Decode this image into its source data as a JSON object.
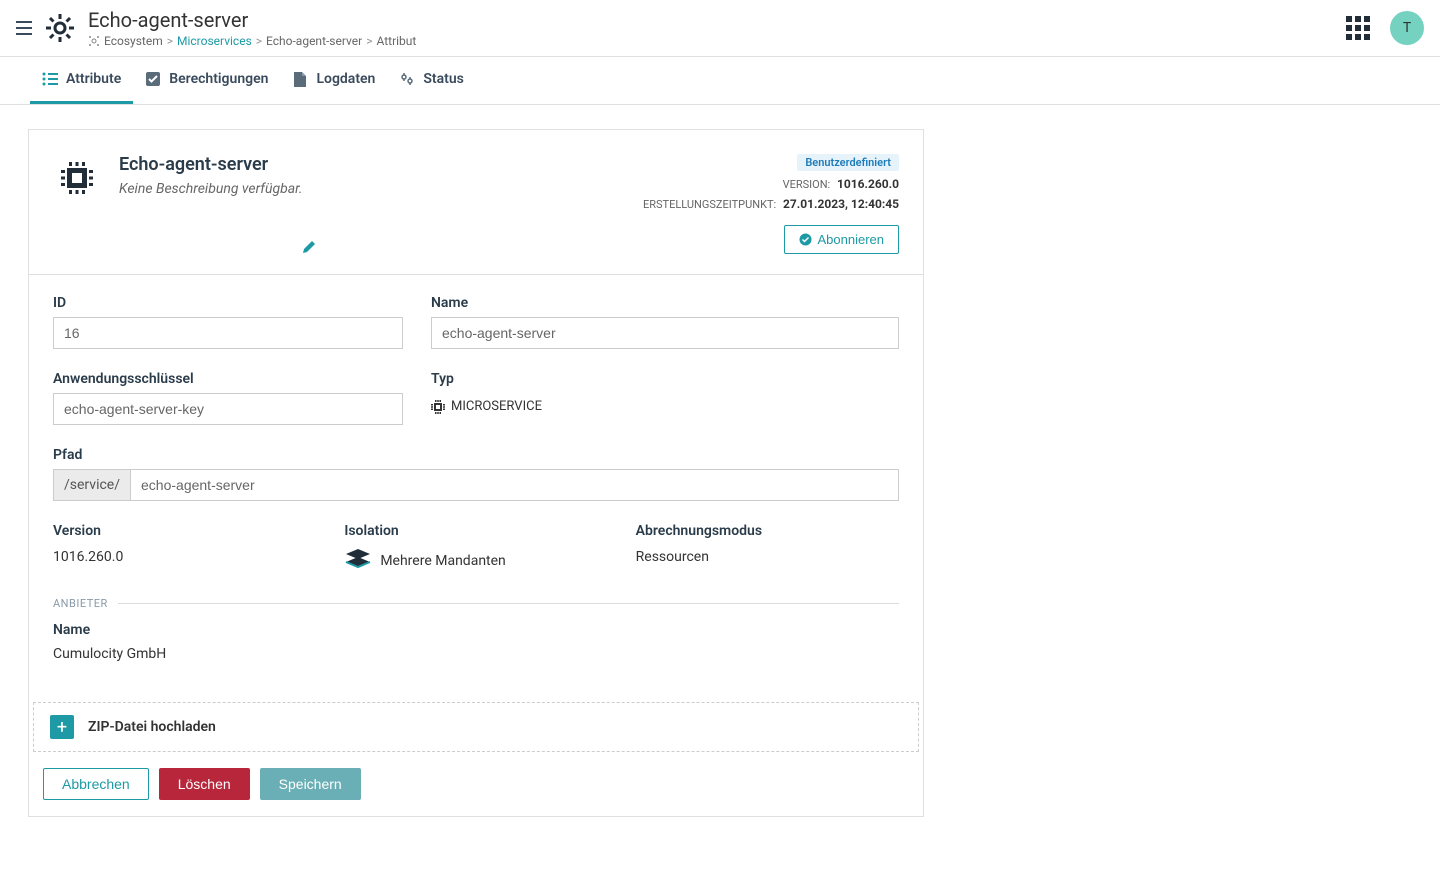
{
  "header": {
    "title": "Echo-agent-server",
    "avatar": "T"
  },
  "breadcrumb": {
    "items": [
      "Ecosystem",
      "Microservices",
      "Echo-agent-server",
      "Attribut"
    ],
    "linkIndex": 1
  },
  "tabs": [
    {
      "label": "Attribute",
      "icon": "list"
    },
    {
      "label": "Berechtigungen",
      "icon": "check"
    },
    {
      "label": "Logdaten",
      "icon": "file"
    },
    {
      "label": "Status",
      "icon": "gear"
    }
  ],
  "card": {
    "title": "Echo-agent-server",
    "description": "Keine Beschreibung verfügbar.",
    "badge": "Benutzerdefiniert",
    "versionLabel": "VERSION:",
    "versionValue": "1016.260.0",
    "createdLabel": "ERSTELLUNGSZEITPUNKT:",
    "createdValue": "27.01.2023, 12:40:45",
    "subscribe": "Abonnieren"
  },
  "form": {
    "idLabel": "ID",
    "idValue": "16",
    "nameLabel": "Name",
    "nameValue": "echo-agent-server",
    "appKeyLabel": "Anwendungsschlüssel",
    "appKeyValue": "echo-agent-server-key",
    "typeLabel": "Typ",
    "typeValue": "MICROSERVICE",
    "pathLabel": "Pfad",
    "pathPrefix": "/service/",
    "pathValue": "echo-agent-server",
    "versionLabel": "Version",
    "versionValue": "1016.260.0",
    "isolationLabel": "Isolation",
    "isolationValue": "Mehrere Mandanten",
    "billingLabel": "Abrechnungsmodus",
    "billingValue": "Ressourcen"
  },
  "provider": {
    "sectionLabel": "ANBIETER",
    "nameLabel": "Name",
    "nameValue": "Cumulocity GmbH"
  },
  "upload": {
    "label": "ZIP-Datei hochladen"
  },
  "actions": {
    "cancel": "Abbrechen",
    "delete": "Löschen",
    "save": "Speichern"
  }
}
